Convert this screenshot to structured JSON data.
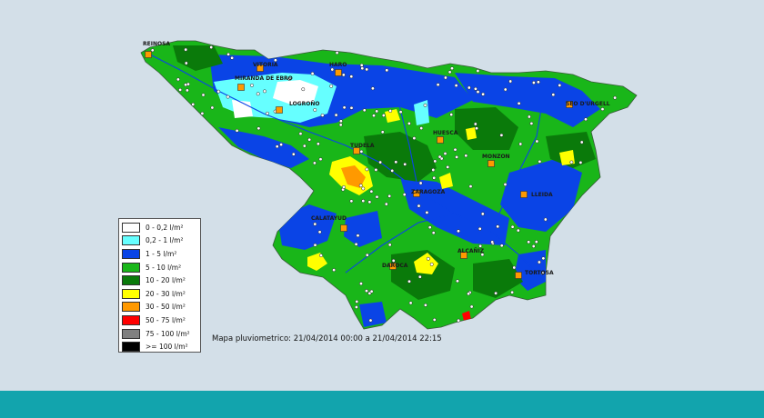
{
  "cities": [
    {
      "name": "REINOSA",
      "marker": "square"
    },
    {
      "name": "MIRANDA DE EBRO",
      "marker": "square"
    },
    {
      "name": "LOGROÑO",
      "marker": "square"
    },
    {
      "name": "VITORIA",
      "marker": "square"
    },
    {
      "name": "TUDELA",
      "marker": "square"
    },
    {
      "name": "HUESCA",
      "marker": "square"
    },
    {
      "name": "SEO D'URGELL",
      "marker": "square"
    },
    {
      "name": "ZARAGOZA",
      "marker": "square"
    },
    {
      "name": "LLEIDA",
      "marker": "square"
    },
    {
      "name": "CALATAYUD",
      "marker": "square"
    },
    {
      "name": "DAROCA",
      "marker": "square"
    },
    {
      "name": "ALCAÑIZ",
      "marker": "square"
    },
    {
      "name": "TORTOSA",
      "marker": "square"
    },
    {
      "name": "MONZON",
      "marker": "square"
    },
    {
      "name": "HARO",
      "marker": "square"
    }
  ],
  "legend": {
    "items": [
      {
        "label": "0 - 0,2 l/m²",
        "color": "#ffffff"
      },
      {
        "label": "0,2 - 1 l/m²",
        "color": "#66ffff"
      },
      {
        "label": "1 - 5 l/m²",
        "color": "#0a44e6"
      },
      {
        "label": "5 - 10 l/m²",
        "color": "#19b619"
      },
      {
        "label": "10 - 20 l/m²",
        "color": "#0a7a0a"
      },
      {
        "label": "20 - 30 l/m²",
        "color": "#ffff00"
      },
      {
        "label": "30 - 50 l/m²",
        "color": "#ff9900"
      },
      {
        "label": "50 - 75 l/m²",
        "color": "#ff0000"
      },
      {
        "label": "75 - 100 l/m²",
        "color": "#808080"
      },
      {
        "label": ">= 100 l/m²",
        "color": "#000000"
      }
    ]
  },
  "caption": "Mapa pluviometrico: 21/04/2014 00:00 a 21/04/2014 22:15",
  "colors": {
    "background": "#d3dfe8",
    "footer": "#12a4ad",
    "station_marker": "#ffffff",
    "city_marker": "#ff9900"
  }
}
